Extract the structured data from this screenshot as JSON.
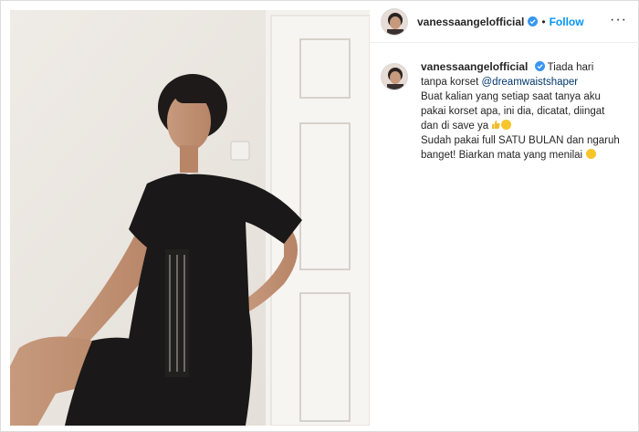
{
  "post": {
    "username": "vanessaangelofficial",
    "separator": "•",
    "follow_label": "Follow",
    "more_label": "···"
  },
  "caption": {
    "username": "vanessaangelofficial",
    "line1_text": "Tiada hari tanpa korset",
    "mention": "@dreamwaistshaper",
    "para2": "Buat kalian yang setiap saat tanya aku pakai korset apa, ini dia, dicatat, diingat dan di save ya",
    "para3": "Sudah pakai full SATU BULAN dan ngaruh banget! Biarkan mata yang menilai"
  },
  "icons": {
    "verified": "verified-badge-icon",
    "more": "more-options-icon",
    "emoji_thumb": "thumbs-up-emoji",
    "emoji_grin": "grinning-emoji",
    "emoji_laugh": "laughing-emoji"
  },
  "colors": {
    "link_blue": "#0095f6",
    "mention": "#00376b",
    "verified": "#3897f0",
    "border": "#dbdbdb"
  }
}
